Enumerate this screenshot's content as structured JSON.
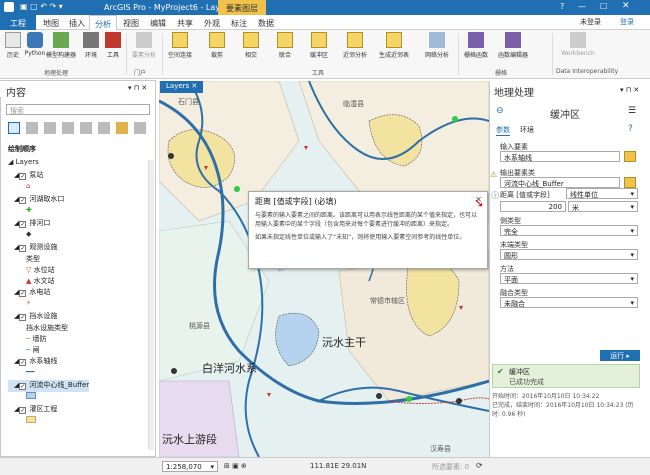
{
  "app": {
    "title": "ArcGIS Pro - MyProject6 - Layers",
    "context_tab": "要素图层",
    "signin": "登录",
    "signin_badge": "未登录"
  },
  "tabs": [
    "工程",
    "地图",
    "插入",
    "分析",
    "视图",
    "编辑",
    "共享",
    "外观",
    "标注",
    "数据"
  ],
  "ribbon": {
    "buttons": [
      "历史",
      "Python",
      "模型构建器",
      "环境",
      "工具",
      "要素分析",
      "空间连接",
      "裁剪",
      "相交",
      "联合",
      "缓冲区",
      "近邻分析",
      "生成近邻表",
      "网络分析",
      "栅格函数",
      "函数编辑器",
      "Workbench"
    ],
    "groups": [
      "地理处理",
      "门户",
      "工具",
      "栅格",
      "Data Interoperability"
    ]
  },
  "contents": {
    "title": "内容",
    "search_placeholder": "搜索",
    "drawing_order": "绘制顺序",
    "map": "Layers",
    "layers": [
      {
        "label": "泵站",
        "checked": true
      },
      {
        "label": "河湖取水口",
        "checked": true
      },
      {
        "label": "排河口",
        "checked": true
      },
      {
        "label": "观测设施",
        "checked": true
      },
      {
        "label": "类型",
        "checked": false
      },
      {
        "label": "水位站",
        "checked": false
      },
      {
        "label": "水文站",
        "checked": false
      },
      {
        "label": "水电站",
        "checked": true
      },
      {
        "label": "挡水设施",
        "checked": true
      },
      {
        "label": "挡水设施类型",
        "checked": false
      },
      {
        "label": "墙防",
        "checked": false
      },
      {
        "label": "闸",
        "checked": false
      },
      {
        "label": "水系轴线",
        "checked": true
      },
      {
        "label": "河流中心线_Buffer",
        "checked": true
      },
      {
        "label": "灌区工程",
        "checked": true
      }
    ]
  },
  "map": {
    "tab": "Layers",
    "labels": [
      "石门县",
      "临澧县",
      "桃源县",
      "常德市辖区",
      "白洋河水系",
      "沅水主干",
      "沅水上游段",
      "汉寿县"
    ],
    "scale": "1:258,070",
    "coords": "111.81E 29.01N",
    "selected": "所选要素: 0"
  },
  "tooltip": {
    "title": "距离 [值或字段] (必填)",
    "body": "与要素的输入要素之间的距离。该距离可以用表示线性距离的某个值来指定，也可以用输入要素中的某个字段（包含用来对每个要素进行缓冲的距离）来指定。",
    "body2": "如果未指定线性单位或输入了“未知”，则将使用输入要素空间参考的线性单位。"
  },
  "geoprocessing": {
    "title": "地理处理",
    "tool": "缓冲区",
    "tab_params": "参数",
    "tab_env": "环境",
    "input_label": "输入要素",
    "input_value": "水系轴线",
    "output_label": "输出要素类",
    "output_value": "河流中心线_Buffer",
    "distance_label": "距离 [值或字段]",
    "distance_type": "线性单位",
    "distance_value": "200",
    "distance_unit": "米",
    "side_label": "侧类型",
    "side_value": "完全",
    "end_label": "末端类型",
    "end_value": "圆形",
    "method_label": "方法",
    "method_value": "平面",
    "dissolve_label": "融合类型",
    "dissolve_value": "未融合",
    "run": "运行",
    "result_title": "缓冲区",
    "result_status": "已成功完成",
    "start": "开始时间：2016年10月10日 10:34:22",
    "done": "已完成，结束时间：2016年10月10日 10:34:23 (历时: 0.96 秒)"
  }
}
